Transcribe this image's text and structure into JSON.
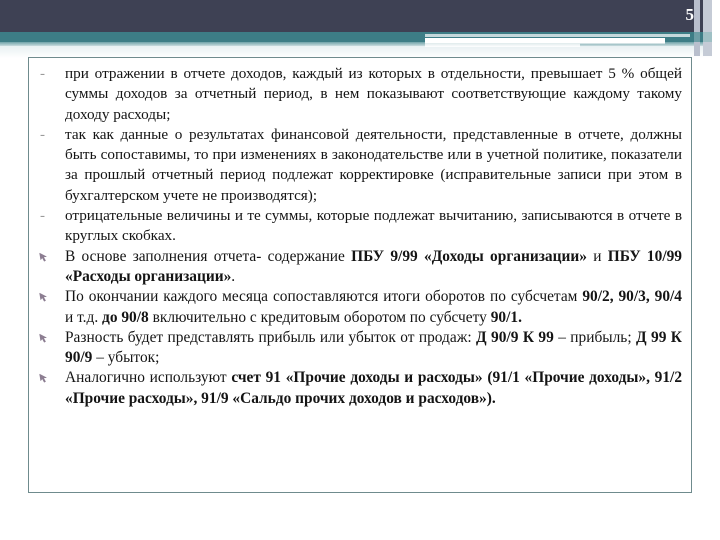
{
  "slide": {
    "page_number": "5",
    "accent_navy": "#3e4154",
    "accent_teal": "#3d7d86",
    "border_color": "#6f8b8d",
    "dash_marker": "-",
    "arrow_marker": "Ø"
  },
  "content": {
    "items": [
      {
        "marker": "dash",
        "text": "при отражении в отчете доходов, каждый из которых в отдельности, превышает 5 % общей суммы доходов за отчетный период, в нем показывают соответствующие каждому такому доходу расходы;"
      },
      {
        "marker": "dash",
        "text": "так как данные о результатах финансовой деятельности, представленные в отчете, должны быть сопоставимы, то при изменениях в законодательстве или в учетной политике, показатели за прошлый отчетный период подлежат корректировке (исправительные записи при этом в бухгалтерском учете не производятся);"
      },
      {
        "marker": "dash",
        "text": "отрицательные величины и те суммы, которые подлежат вычитанию, записываются в отчете в круглых скобках."
      },
      {
        "marker": "arrow",
        "parts": [
          {
            "t": "В основе заполнения отчета- содержание ",
            "b": false
          },
          {
            "t": "ПБУ 9/99 «Доходы организации» ",
            "b": true
          },
          {
            "t": "и ",
            "b": false
          },
          {
            "t": "ПБУ 10/99 «Расходы организации»",
            "b": true
          },
          {
            "t": ".",
            "b": false
          }
        ]
      },
      {
        "marker": "arrow",
        "parts": [
          {
            "t": "По окончании каждого месяца сопоставляются итоги оборотов по субсчетам ",
            "b": false
          },
          {
            "t": "90/2, 90/3, 90/4 ",
            "b": true
          },
          {
            "t": "и т.д. ",
            "b": false
          },
          {
            "t": "до 90/8 ",
            "b": true
          },
          {
            "t": "включительно с кредитовым оборотом по субсчету ",
            "b": false
          },
          {
            "t": "90/1.",
            "b": true
          }
        ]
      },
      {
        "marker": "arrow",
        "parts": [
          {
            "t": "Разность будет представлять прибыль или убыток от продаж: ",
            "b": false
          },
          {
            "t": "Д 90/9 К 99 ",
            "b": true
          },
          {
            "t": "– прибыль; ",
            "b": false
          },
          {
            "t": "Д 99 К 90/9 ",
            "b": true
          },
          {
            "t": "– убыток;",
            "b": false
          }
        ]
      },
      {
        "marker": "arrow",
        "parts": [
          {
            "t": "Аналогично используют ",
            "b": false
          },
          {
            "t": "счет 91 «Прочие доходы и расходы» (91/1 «Прочие доходы», 91/2 «Прочие расходы», 91/9 «Сальдо прочих доходов и расходов»).",
            "b": true
          }
        ]
      }
    ]
  }
}
